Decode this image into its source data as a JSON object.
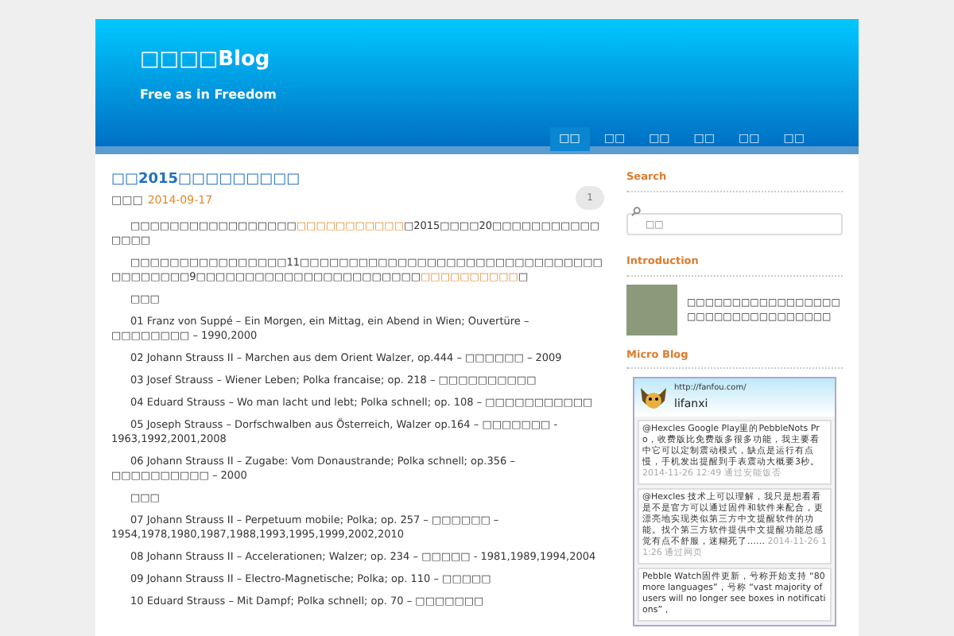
{
  "header": {
    "site_title": "□□□□Blog",
    "tagline": "Free as in Freedom",
    "nav": [
      {
        "label": "□□",
        "selected": true
      },
      {
        "label": "□□",
        "selected": false
      },
      {
        "label": "□□",
        "selected": false
      },
      {
        "label": "□□",
        "selected": false
      },
      {
        "label": "□□",
        "selected": false
      },
      {
        "label": "□□",
        "selected": false
      }
    ]
  },
  "post": {
    "title": "□□2015□□□□□□□□□",
    "author": "□□□",
    "date": "2014-09-17",
    "comments": "1",
    "body": [
      {
        "kind": "para",
        "parts": [
          {
            "text": "□□□□□□□□□□□□□□□□□",
            "link": false
          },
          {
            "text": "□□□□□□□□□□□",
            "link": true
          },
          {
            "text": "□2015□□□□20□□□□□□□□□□□□□□□",
            "link": false
          }
        ]
      },
      {
        "kind": "para",
        "parts": [
          {
            "text": "□□□□□□□□□□□□□□□□11□□□□□□□□□□□□□□□□□□□□□□□□□□□□□□□□□□□□□□□9□□□□□□□□□□□□□□□□□□□□□□□",
            "link": false
          },
          {
            "text": "□□□□□□□□□□",
            "link": true
          },
          {
            "text": "□",
            "link": false
          }
        ]
      },
      {
        "kind": "heading",
        "text": "□□□"
      },
      {
        "kind": "item",
        "text": "01 Franz von Suppé – Ein Morgen, ein Mittag, ein Abend in Wien; Ouvertüre – □□□□□□□□ – 1990,2000"
      },
      {
        "kind": "item",
        "text": "02 Johann Strauss II – Marchen aus dem Orient Walzer, op.444 – □□□□□□ – 2009"
      },
      {
        "kind": "item",
        "text": "03 Josef Strauss – Wiener Leben; Polka francaise; op. 218 – □□□□□□□□□□"
      },
      {
        "kind": "item",
        "text": "04 Eduard Strauss – Wo man lacht und lebt; Polka schnell; op. 108 – □□□□□□□□□□□"
      },
      {
        "kind": "item",
        "text": "05 Joseph Strauss – Dorfschwalben aus Österreich, Walzer op.164 – □□□□□□□ - 1963,1992,2001,2008"
      },
      {
        "kind": "item",
        "text": "06 Johann Strauss II – Zugabe: Vom Donaustrande; Polka schnell; op.356 – □□□□□□□□□□ – 2000"
      },
      {
        "kind": "heading",
        "text": "□□□"
      },
      {
        "kind": "item",
        "text": "07 Johann Strauss II – Perpetuum mobile; Polka; op. 257 – □□□□□□ – 1954,1978,1980,1987,1988,1993,1995,1999,2002,2010"
      },
      {
        "kind": "item",
        "text": "08 Johann Strauss II – Accelerationen; Walzer; op. 234 – □□□□□ - 1981,1989,1994,2004"
      },
      {
        "kind": "item",
        "text": "09 Johann Strauss II – Electro-Magnetische; Polka; op. 110 – □□□□□"
      },
      {
        "kind": "item",
        "text": "10 Eduard Strauss – Mit Dampf; Polka schnell; op. 70 – □□□□□□□"
      }
    ]
  },
  "sidebar": {
    "search": {
      "heading": "Search",
      "placeholder": "□□"
    },
    "introduction": {
      "heading": "Introduction",
      "text": "□□□□□□□□□□□□□□□□□□□□□□□□□□□□□□□□□"
    },
    "micro_blog": {
      "heading": "Micro Blog",
      "url": "http://fanfou.com/",
      "name": "lifanxi",
      "posts": [
        {
          "text": "@Hexcles Google Play里的PebbleNots Pro，收费版比免费版多很多功能，我主要看中它可以定制震动模式，缺点是运行有点慢，手机发出提醒到手表震动大概要3秒。",
          "time": "2014-11-26 12:49",
          "source": "通过安能饭否"
        },
        {
          "text": "@Hexcles 技术上可以理解，我只是想看看是不是官方可以通过固件和软件来配合，更漂亮地实现类似第三方中文提醒软件的功能。找个第三方软件提供中文提醒功能总感觉有点不舒服，迷糊死了……",
          "time": "2014-11-26 11:26",
          "source": "通过网页"
        },
        {
          "text": "Pebble Watch固件更新，号称开始支持 “80 more languages”，号称 “vast majority of users will no longer see boxes in notifications”，"
        }
      ]
    }
  }
}
